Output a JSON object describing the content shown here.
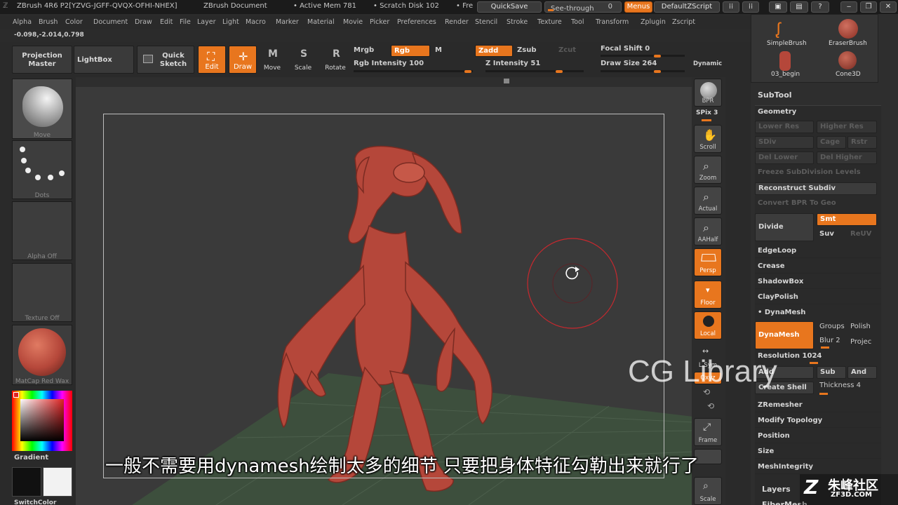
{
  "titlebar": {
    "app": "ZBrush 4R6 P2[YZVG-JGFF-QVQX-OFHI-NHEX]",
    "document": "ZBrush Document",
    "active_mem": "• Active Mem 781",
    "scratch": "• Scratch Disk 102",
    "free": "• Fre",
    "quicksave": "QuickSave",
    "see_through": "See-through",
    "see_through_value": "0",
    "menus": "Menus",
    "default_zscript": "DefaultZScript"
  },
  "menubar": [
    "Alpha",
    "Brush",
    "Color",
    "Document",
    "Draw",
    "Edit",
    "File",
    "Layer",
    "Light",
    "Macro",
    "Marker",
    "Material",
    "Movie",
    "Picker",
    "Preferences",
    "Render",
    "Stencil",
    "Stroke",
    "Texture",
    "Tool",
    "Transform",
    "Zplugin",
    "Zscript"
  ],
  "coords": "-0.098,-2.014,0.798",
  "toolbar": {
    "projection_master": "Projection Master",
    "lightbox": "LightBox",
    "quick_sketch": "Quick Sketch",
    "edit": "Edit",
    "draw": "Draw",
    "move": "Move",
    "scale": "Scale",
    "rotate": "Rotate",
    "mrgb": "Mrgb",
    "rgb": "Rgb",
    "m": "M",
    "zadd": "Zadd",
    "zsub": "Zsub",
    "zcut": "Zcut",
    "rgb_intensity": "Rgb Intensity 100",
    "z_intensity": "Z Intensity 51",
    "focal_shift": "Focal Shift 0",
    "draw_size": "Draw Size 264",
    "dynamic": "Dynamic"
  },
  "leftshelf": {
    "move": "Move",
    "dots": "Dots",
    "alpha_off": "Alpha Off",
    "texture_off": "Texture Off",
    "matcap": "MatCap Red Wax",
    "gradient": "Gradient",
    "switchcolor": "SwitchColor"
  },
  "rightshelf": {
    "bpr": "BPR",
    "spix": "SPix 3",
    "scroll": "Scroll",
    "zoom": "Zoom",
    "actual": "Actual",
    "aahalf": "AAHalf",
    "persp": "Persp",
    "floor": "Floor",
    "local": "Local",
    "lsym": "L.Sym",
    "xyz": "Qxyz",
    "frame": "Frame",
    "scale": "Scale"
  },
  "tools": {
    "simplebrush": "SimpleBrush",
    "eraserbrush": "EraserBrush",
    "begin": "03_begin",
    "cone3d": "Cone3D"
  },
  "panel": {
    "subtool": "SubTool",
    "geometry": "Geometry",
    "lower_res": "Lower Res",
    "higher_res": "Higher Res",
    "sdiv": "SDiv",
    "cage": "Cage",
    "rstr": "Rstr",
    "del_lower": "Del Lower",
    "del_higher": "Del Higher",
    "freeze": "Freeze SubDivision Levels",
    "reconstruct": "Reconstruct Subdiv",
    "convert_bpr": "Convert BPR To Geo",
    "divide": "Divide",
    "smt": "Smt",
    "suv": "Suv",
    "reuv": "ReUV",
    "edgeloop": "EdgeLoop",
    "crease": "Crease",
    "shadowbox": "ShadowBox",
    "claypolish": "ClayPolish",
    "dynamesh_header": "DynaMesh",
    "dynamesh_btn": "DynaMesh",
    "groups": "Groups",
    "polish": "Polish",
    "blur": "Blur 2",
    "project": "Projec",
    "resolution": "Resolution 1024",
    "add": "Add",
    "sub": "Sub",
    "and": "And",
    "create_shell": "Create Shell",
    "thickness": "Thickness 4",
    "zremesher": "ZRemesher",
    "modify_topology": "Modify Topology",
    "position": "Position",
    "size": "Size",
    "meshintegrity": "MeshIntegrity",
    "layers": "Layers",
    "fibermesh": "FiberMesh"
  },
  "overlay": {
    "subtitle": "一般不需要用dynamesh绘制太多的细节 只要把身体特征勾勒出来就行了",
    "watermark": "CG Library",
    "logo": "朱峰社区",
    "logo_sub": "ZF3D.COM"
  },
  "colors": {
    "accent": "#e8761e",
    "model": "#b5473a",
    "floor_grid": "#3d4f3d"
  }
}
